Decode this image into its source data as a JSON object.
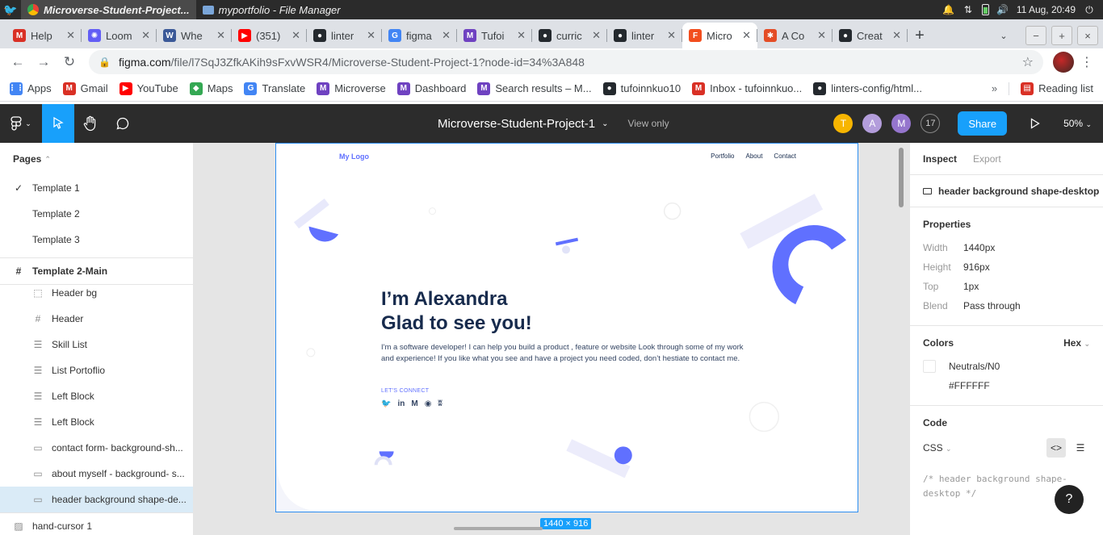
{
  "os": {
    "tasks": [
      {
        "label": "Microverse-Student-Project...",
        "active": true
      },
      {
        "label": "myportfolio - File Manager",
        "active": false
      }
    ],
    "clock": "11 Aug, 20:49"
  },
  "tabs": [
    {
      "label": "Help",
      "color": "#d93025",
      "glyph": "M"
    },
    {
      "label": "Loom",
      "color": "#625df5",
      "glyph": "✺"
    },
    {
      "label": "Whe",
      "color": "#3b5998",
      "glyph": "W"
    },
    {
      "label": "(351)",
      "color": "#ff0000",
      "glyph": "▶"
    },
    {
      "label": "linter",
      "color": "#24292e",
      "glyph": "●"
    },
    {
      "label": "figma",
      "color": "#4285f4",
      "glyph": "G"
    },
    {
      "label": "Tufoi",
      "color": "#6f42c1",
      "glyph": "M"
    },
    {
      "label": "curric",
      "color": "#24292e",
      "glyph": "●"
    },
    {
      "label": "linter",
      "color": "#24292e",
      "glyph": "●"
    },
    {
      "label": "Micro",
      "color": "#f24e1e",
      "glyph": "F",
      "active": true
    },
    {
      "label": "A Co",
      "color": "#e44d26",
      "glyph": "✱"
    },
    {
      "label": "Creat",
      "color": "#24292e",
      "glyph": "●"
    }
  ],
  "address": {
    "host": "figma.com",
    "path": "/file/l7SqJ3ZfkAKih9sFxvWSR4/Microverse-Student-Project-1?node-id=34%3A848"
  },
  "bookmarks": [
    {
      "label": "Apps",
      "color": "#4285f4",
      "glyph": "⋮⋮"
    },
    {
      "label": "Gmail",
      "color": "#d93025",
      "glyph": "M"
    },
    {
      "label": "YouTube",
      "color": "#ff0000",
      "glyph": "▶"
    },
    {
      "label": "Maps",
      "color": "#34a853",
      "glyph": "◆"
    },
    {
      "label": "Translate",
      "color": "#4285f4",
      "glyph": "G"
    },
    {
      "label": "Microverse",
      "color": "#6f42c1",
      "glyph": "M"
    },
    {
      "label": "Dashboard",
      "color": "#6f42c1",
      "glyph": "M"
    },
    {
      "label": "Search results – M...",
      "color": "#6f42c1",
      "glyph": "M"
    },
    {
      "label": "tufoinnkuo10",
      "color": "#24292e",
      "glyph": "●"
    },
    {
      "label": "Inbox - tufoinnkuo...",
      "color": "#d93025",
      "glyph": "M"
    },
    {
      "label": "linters-config/html...",
      "color": "#24292e",
      "glyph": "●"
    }
  ],
  "reading_list": "Reading list",
  "figma": {
    "file_title": "Microverse-Student-Project-1",
    "view_only": "View only",
    "presence": [
      {
        "initial": "T",
        "color": "#f7b500"
      },
      {
        "initial": "A",
        "color": "#b39ddb"
      },
      {
        "initial": "M",
        "color": "#9575cd"
      }
    ],
    "viewer_count": "17",
    "share_label": "Share",
    "zoom": "50%"
  },
  "left": {
    "pages_label": "Pages",
    "pages": [
      {
        "label": "Template 1",
        "current": true
      },
      {
        "label": "Template 2",
        "current": false
      },
      {
        "label": "Template 3",
        "current": false
      }
    ],
    "frame_label": "Template 2-Main",
    "layers": [
      {
        "label": "Header bg",
        "icon": "dashed"
      },
      {
        "label": "Header",
        "icon": "frame"
      },
      {
        "label": "Skill List",
        "icon": "list"
      },
      {
        "label": "List Portoflio",
        "icon": "list"
      },
      {
        "label": "Left Block",
        "icon": "list"
      },
      {
        "label": "Left Block",
        "icon": "list"
      },
      {
        "label": "contact form- background-sh...",
        "icon": "rect"
      },
      {
        "label": "about myself - background- s...",
        "icon": "rect"
      },
      {
        "label": "header background shape-de...",
        "icon": "rect",
        "selected": true
      }
    ],
    "bottom_layer": "hand-cursor 1"
  },
  "canvas": {
    "logo": "My Logo",
    "nav": [
      "Portfolio",
      "About",
      "Contact"
    ],
    "h1_line1": "I’m Alexandra",
    "h1_line2": "Glad to see you!",
    "intro": "I'm a software developer! I can help you build a product , feature or website Look through some of my work and experience! If you like what you see and have a project you need coded, don’t hestiate to contact me.",
    "connect": "LET'S CONNECT",
    "social": [
      "🐦",
      "in",
      "M",
      "◉",
      "ʬ"
    ],
    "size_badge": "1440 × 916",
    "accent": "#6070ff"
  },
  "right": {
    "tabs": [
      "Inspect",
      "Export"
    ],
    "layer_name": "header background shape-desktop",
    "properties_title": "Properties",
    "props": [
      {
        "k": "Width",
        "v": "1440px"
      },
      {
        "k": "Height",
        "v": "916px"
      },
      {
        "k": "Top",
        "v": "1px"
      },
      {
        "k": "Blend",
        "v": "Pass through"
      }
    ],
    "colors_title": "Colors",
    "color_format": "Hex",
    "color_name": "Neutrals/N0",
    "color_hex": "#FFFFFF",
    "code_title": "Code",
    "code_lang": "CSS",
    "code_comment_1": "/* header background shape-",
    "code_comment_2": "desktop */",
    "help": "?"
  }
}
